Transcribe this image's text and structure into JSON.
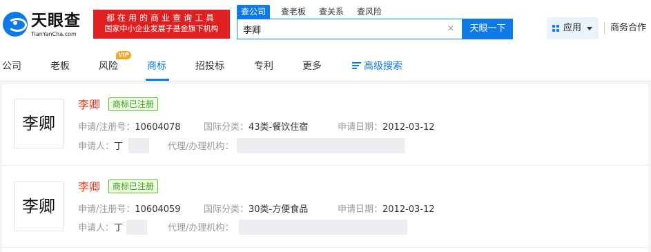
{
  "header": {
    "logo_text": "天眼查",
    "logo_sub": "TianYanCha.com",
    "slogan_line1": "都在用的商业查询工具",
    "slogan_line2": "国家中小企业发展子基金旗下机构",
    "search_tabs": [
      "查公司",
      "查老板",
      "查关系",
      "查风险"
    ],
    "search_value": "李卿",
    "search_button": "天眼一下",
    "apps_label": "应用",
    "business_label": "商务合作"
  },
  "nav": {
    "items": [
      "公司",
      "老板",
      "风险",
      "商标",
      "招投标",
      "专利",
      "更多"
    ],
    "active": "商标",
    "vip_badge": "VIP",
    "advanced_search": "高级搜索"
  },
  "colors": {
    "brand_blue": "#0d7ae8",
    "slogan_red": "#e02020",
    "name_red": "#e8381b",
    "badge_green": "#52c41a"
  },
  "trademarks": [
    {
      "image_text": "李卿",
      "name": "李卿",
      "status": "商标已注册",
      "reg_label": "申请/注册号：",
      "reg_no": "10604078",
      "class_label": "国际分类：",
      "class": "43类-餐饮住宿",
      "date_label": "申请日期：",
      "date": "2012-03-12",
      "applicant_label": "申请人：",
      "applicant": "丁",
      "agent_label": "代理/办理机构："
    },
    {
      "image_text": "李卿",
      "name": "李卿",
      "status": "商标已注册",
      "reg_label": "申请/注册号：",
      "reg_no": "10604059",
      "class_label": "国际分类：",
      "class": "30类-方便食品",
      "date_label": "申请日期：",
      "date": "2012-03-12",
      "applicant_label": "申请人：",
      "applicant": "丁",
      "agent_label": "代理/办理机构："
    }
  ]
}
